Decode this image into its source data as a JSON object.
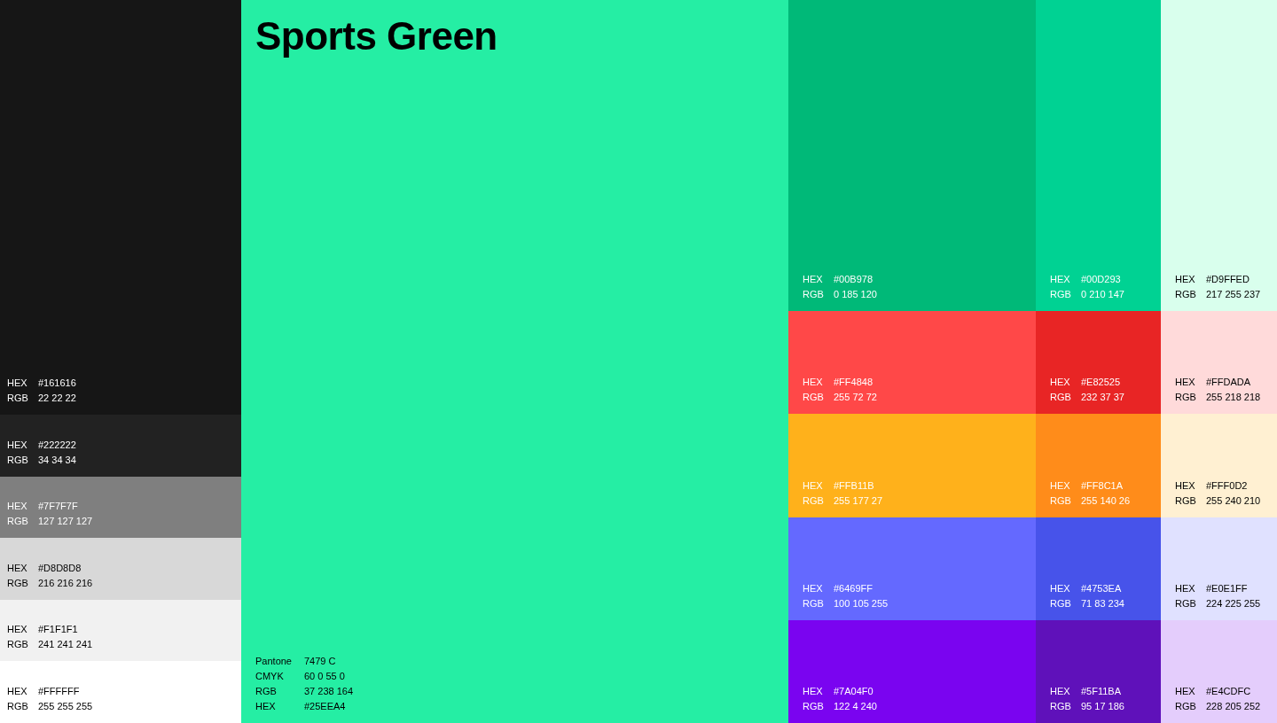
{
  "neutrals": [
    {
      "color": "#161616",
      "kind": "dark",
      "specs": [
        {
          "label": "HEX",
          "value": "#161616"
        },
        {
          "label": "RGB",
          "value": "22 22 22"
        }
      ]
    },
    {
      "color": "#222222",
      "kind": "dark",
      "specs": [
        {
          "label": "HEX",
          "value": "#222222"
        },
        {
          "label": "RGB",
          "value": "34 34 34"
        }
      ]
    },
    {
      "color": "#7f7f7f",
      "kind": "dark",
      "specs": [
        {
          "label": "HEX",
          "value": "#7F7F7F"
        },
        {
          "label": "RGB",
          "value": "127 127 127"
        }
      ]
    },
    {
      "color": "#d8d8d8",
      "kind": "light",
      "specs": [
        {
          "label": "HEX",
          "value": "#D8D8D8"
        },
        {
          "label": "RGB",
          "value": "216 216 216"
        }
      ]
    },
    {
      "color": "#f1f1f1",
      "kind": "light",
      "specs": [
        {
          "label": "HEX",
          "value": "#F1F1F1"
        },
        {
          "label": "RGB",
          "value": "241 241 241"
        }
      ]
    },
    {
      "color": "#ffffff",
      "kind": "light",
      "specs": [
        {
          "label": "HEX",
          "value": "#FFFFFF"
        },
        {
          "label": "RGB",
          "value": "255 255 255"
        }
      ]
    }
  ],
  "primary": {
    "title": "Sports Green",
    "color": "#25eea4",
    "specs": [
      {
        "label": "Pantone",
        "value": "7479 C"
      },
      {
        "label": "CMYK",
        "value": "60 0 55 0"
      },
      {
        "label": "RGB",
        "value": "37 238 164"
      },
      {
        "label": "HEX",
        "value": "#25EEA4"
      }
    ]
  },
  "palette": [
    {
      "color": "#00b978",
      "kind": "dark",
      "specs": [
        {
          "label": "HEX",
          "value": "#00B978"
        },
        {
          "label": "RGB",
          "value": "0 185 120"
        }
      ]
    },
    {
      "color": "#00d293",
      "kind": "dark",
      "specs": [
        {
          "label": "HEX",
          "value": "#00D293"
        },
        {
          "label": "RGB",
          "value": "0 210 147"
        }
      ]
    },
    {
      "color": "#d9ffed",
      "kind": "light",
      "specs": [
        {
          "label": "HEX",
          "value": "#D9FFED"
        },
        {
          "label": "RGB",
          "value": "217 255 237"
        }
      ]
    },
    {
      "color": "#ff4848",
      "kind": "dark",
      "specs": [
        {
          "label": "HEX",
          "value": "#FF4848"
        },
        {
          "label": "RGB",
          "value": "255 72 72"
        }
      ]
    },
    {
      "color": "#e82525",
      "kind": "dark",
      "specs": [
        {
          "label": "HEX",
          "value": "#E82525"
        },
        {
          "label": "RGB",
          "value": "232 37 37"
        }
      ]
    },
    {
      "color": "#ffdada",
      "kind": "light",
      "specs": [
        {
          "label": "HEX",
          "value": "#FFDADA"
        },
        {
          "label": "RGB",
          "value": "255 218 218"
        }
      ]
    },
    {
      "color": "#ffb11b",
      "kind": "dark",
      "specs": [
        {
          "label": "HEX",
          "value": "#FFB11B"
        },
        {
          "label": "RGB",
          "value": "255 177 27"
        }
      ]
    },
    {
      "color": "#ff8c1a",
      "kind": "dark",
      "specs": [
        {
          "label": "HEX",
          "value": "#FF8C1A"
        },
        {
          "label": "RGB",
          "value": "255 140 26"
        }
      ]
    },
    {
      "color": "#fff0d2",
      "kind": "light",
      "specs": [
        {
          "label": "HEX",
          "value": "#FFF0D2"
        },
        {
          "label": "RGB",
          "value": "255 240 210"
        }
      ]
    },
    {
      "color": "#6469ff",
      "kind": "dark",
      "specs": [
        {
          "label": "HEX",
          "value": "#6469FF"
        },
        {
          "label": "RGB",
          "value": "100 105 255"
        }
      ]
    },
    {
      "color": "#4753ea",
      "kind": "dark",
      "specs": [
        {
          "label": "HEX",
          "value": "#4753EA"
        },
        {
          "label": "RGB",
          "value": "71 83 234"
        }
      ]
    },
    {
      "color": "#e0e1ff",
      "kind": "light",
      "specs": [
        {
          "label": "HEX",
          "value": "#E0E1FF"
        },
        {
          "label": "RGB",
          "value": "224 225 255"
        }
      ]
    },
    {
      "color": "#7a04f0",
      "kind": "dark",
      "specs": [
        {
          "label": "HEX",
          "value": "#7A04F0"
        },
        {
          "label": "RGB",
          "value": "122 4 240"
        }
      ]
    },
    {
      "color": "#5f11ba",
      "kind": "dark",
      "specs": [
        {
          "label": "HEX",
          "value": "#5F11BA"
        },
        {
          "label": "RGB",
          "value": "95 17 186"
        }
      ]
    },
    {
      "color": "#e4cdfc",
      "kind": "light",
      "specs": [
        {
          "label": "HEX",
          "value": "#E4CDFC"
        },
        {
          "label": "RGB",
          "value": "228 205 252"
        }
      ]
    }
  ]
}
